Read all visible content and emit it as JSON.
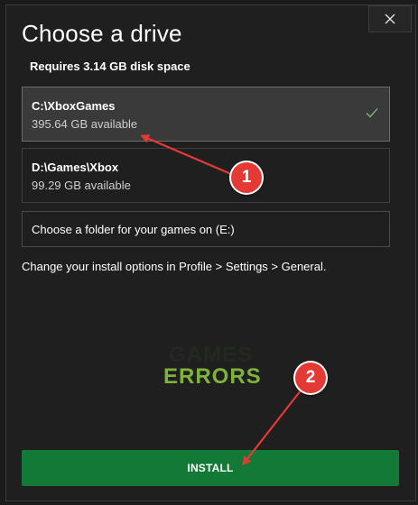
{
  "dialog": {
    "title": "Choose a drive",
    "subtitle": "Requires 3.14 GB disk space",
    "close_icon": "close-icon"
  },
  "drives": [
    {
      "path": "C:\\XboxGames",
      "available": "395.64 GB available",
      "selected": true
    },
    {
      "path": "D:\\Games\\Xbox",
      "available": "99.29 GB available",
      "selected": false
    }
  ],
  "folder_option": "Choose a folder for your games on (E:)",
  "hint": "Change your install options in Profile > Settings > General.",
  "watermark": {
    "top": "GAMES",
    "bottom": "ERRORS"
  },
  "install_label": "INSTALL",
  "annotations": [
    {
      "number": "1"
    },
    {
      "number": "2"
    }
  ],
  "colors": {
    "accent_green": "#127a36",
    "annotation_red": "#e53935",
    "checkmark": "#7fbf7f"
  }
}
